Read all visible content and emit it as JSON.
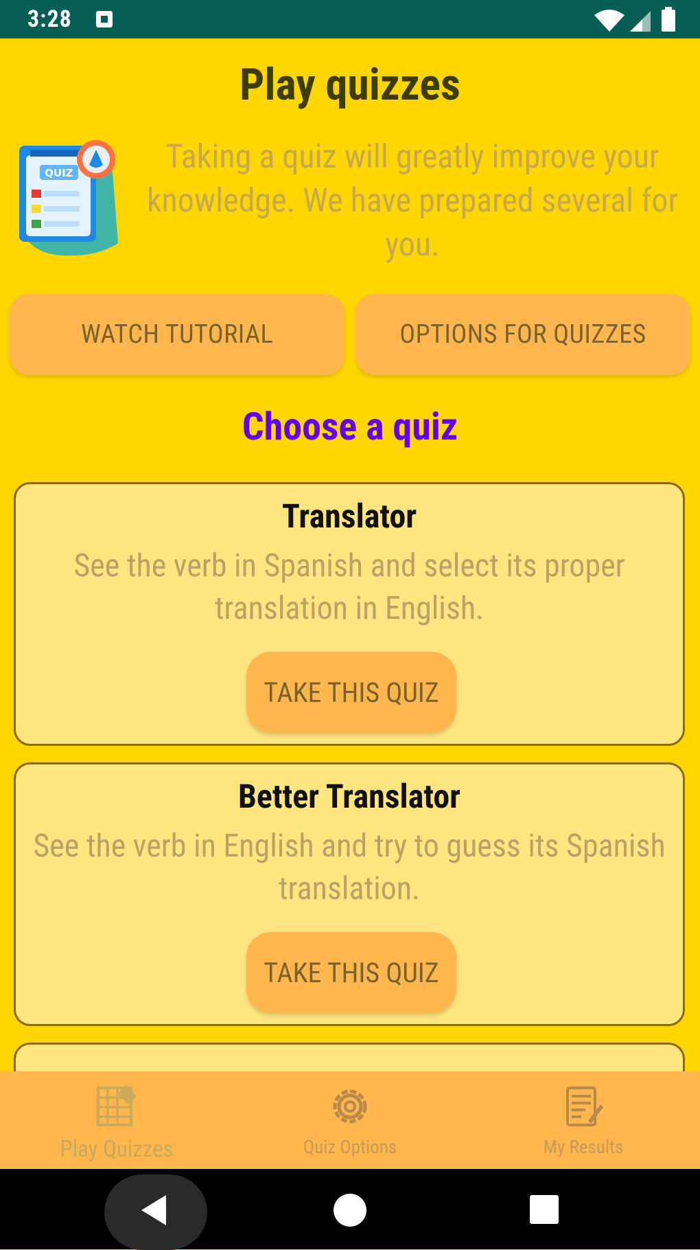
{
  "status_bar": {
    "time": "3:28"
  },
  "page": {
    "title": "Play quizzes",
    "intro_text": "Taking a quiz will greatly improve your knowledge. We have prepared several for you.",
    "hero_icon": "quiz-icon"
  },
  "buttons": {
    "watch_tutorial": "WATCH TUTORIAL",
    "options_for_quizzes": "OPTIONS FOR QUIZZES"
  },
  "choose_title": "Choose a quiz",
  "quizzes": [
    {
      "title": "Translator",
      "description": "See the verb in Spanish and select its proper translation in English.",
      "action_label": "TAKE THIS QUIZ"
    },
    {
      "title": "Better Translator",
      "description": "See the verb in English and try to guess its Spanish translation.",
      "action_label": "TAKE THIS QUIZ"
    }
  ],
  "bottom_nav": {
    "items": [
      {
        "label": "Play Quizzes",
        "icon": "quiz-grid-icon",
        "active": true
      },
      {
        "label": "Quiz Options",
        "icon": "gear-icon",
        "active": false
      },
      {
        "label": "My Results",
        "icon": "results-document-icon",
        "active": false
      }
    ]
  },
  "colors": {
    "background": "#FFD600",
    "status_bar": "#075E54",
    "button": "#FFB74D",
    "card": "#FFE57F",
    "accent_title": "#6200EE"
  }
}
